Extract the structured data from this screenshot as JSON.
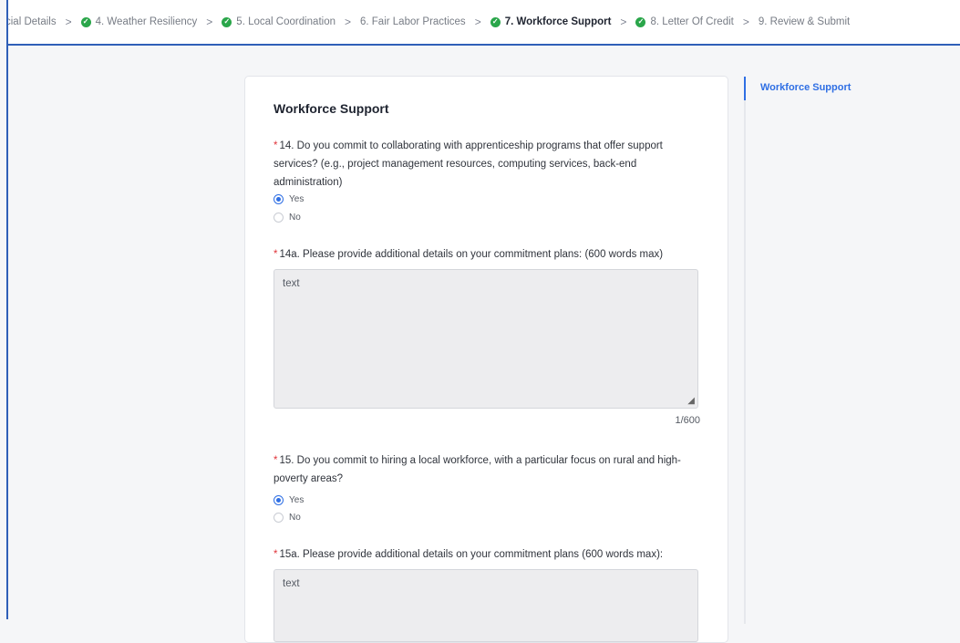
{
  "stepper": {
    "steps": [
      {
        "label": "cial Details",
        "done": false
      },
      {
        "label": "4. Weather Resiliency",
        "done": true
      },
      {
        "label": "5. Local Coordination",
        "done": true
      },
      {
        "label": "6. Fair Labor Practices",
        "done": false
      },
      {
        "label": "7. Workforce Support",
        "done": true,
        "active": true
      },
      {
        "label": "8. Letter Of Credit",
        "done": true
      },
      {
        "label": "9. Review & Submit",
        "done": false
      }
    ],
    "separator": ">"
  },
  "form": {
    "section_title": "Workforce Support",
    "required_marker": "*",
    "q14": {
      "label": "14. Do you commit to collaborating with apprenticeship programs that offer support services? (e.g., project management resources, computing services, back-end administration)",
      "options": [
        "Yes",
        "No"
      ],
      "selected": "Yes"
    },
    "q14a": {
      "label": "14a. Please provide additional details on your commitment plans: (600 words max)",
      "value": "text",
      "counter": "1/600"
    },
    "q15": {
      "label": "15. Do you commit to hiring a local workforce, with a particular focus on rural and high-poverty areas?",
      "options": [
        "Yes",
        "No"
      ],
      "selected": "Yes"
    },
    "q15a": {
      "label": "15a. Please provide additional details on your commitment plans (600 words max):",
      "value": "text"
    }
  },
  "toc": {
    "items": [
      "Workforce Support"
    ],
    "active_color": "#2f6fe4"
  },
  "colors": {
    "accent": "#2f6fe4",
    "success": "#2aa64a",
    "required": "#e0353b"
  }
}
